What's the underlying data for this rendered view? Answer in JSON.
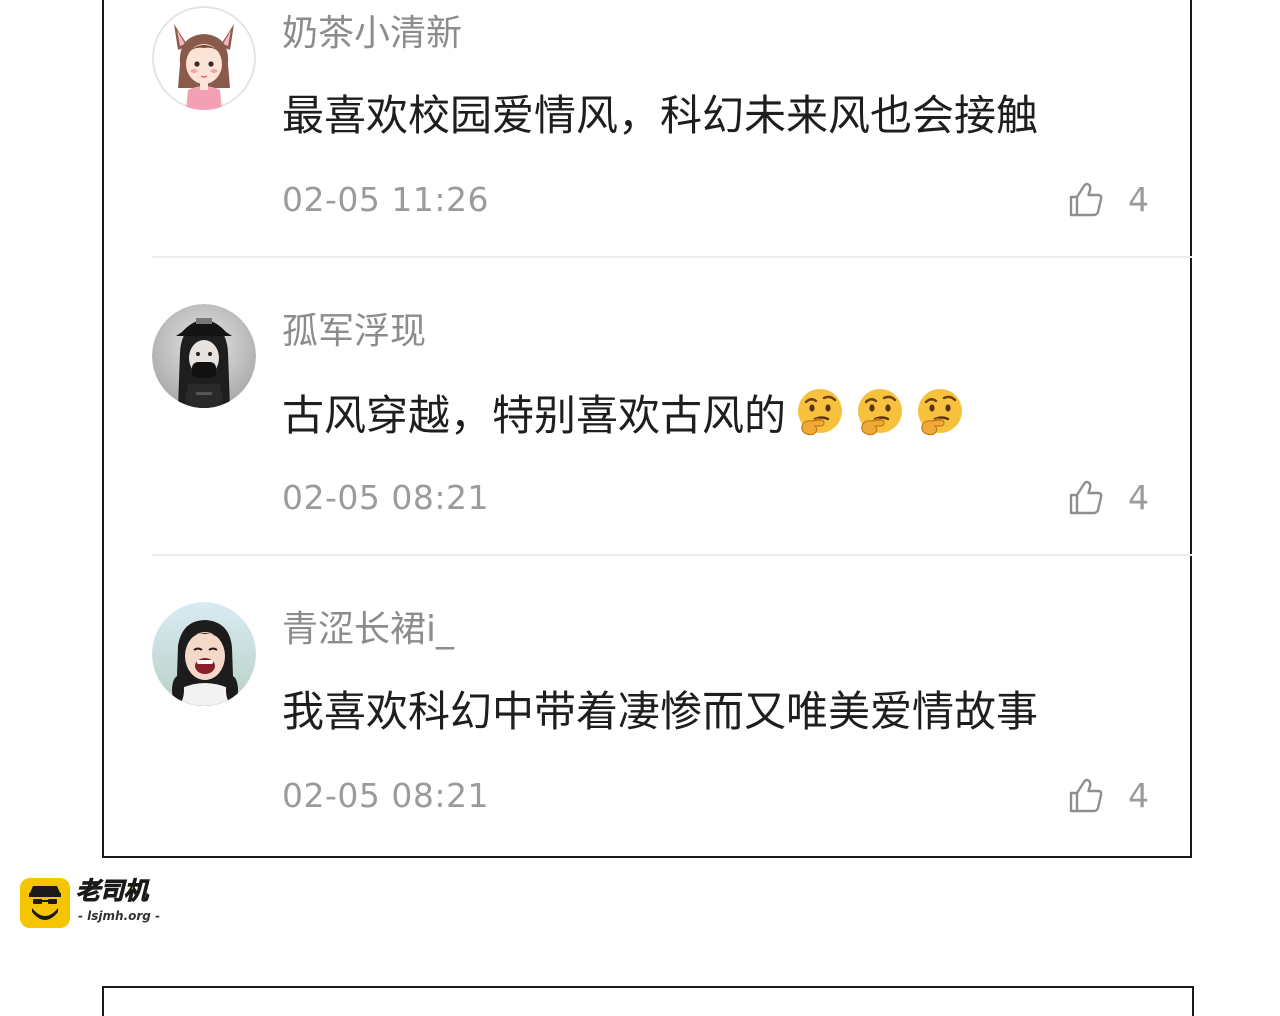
{
  "comments": [
    {
      "username": "奶茶小清新",
      "text": "最喜欢校园爱情风，科幻未来风也会接触",
      "timestamp": "02-05 11:26",
      "likes": "4",
      "avatar_icon": "cat-ear-girl-avatar"
    },
    {
      "username": "孤军浮现",
      "text": "古风穿越，特别喜欢古风的",
      "emoji_icon": "thinking-face-emoji",
      "emoji_count": 3,
      "timestamp": "02-05 08:21",
      "likes": "4",
      "avatar_icon": "masked-girl-avatar"
    },
    {
      "username": "青涩长裙i_",
      "text": "我喜欢科幻中带着凄惨而又唯美爱情故事",
      "timestamp": "02-05 08:21",
      "likes": "4",
      "avatar_icon": "laughing-girl-avatar"
    }
  ],
  "watermark": {
    "title": "老司机",
    "url": "- lsjmh.org -",
    "accent": "#f6c400"
  },
  "colors": {
    "username": "#8c8c8c",
    "body": "#1e1e1e",
    "meta": "#9b9b9b",
    "divider": "#ececec"
  }
}
